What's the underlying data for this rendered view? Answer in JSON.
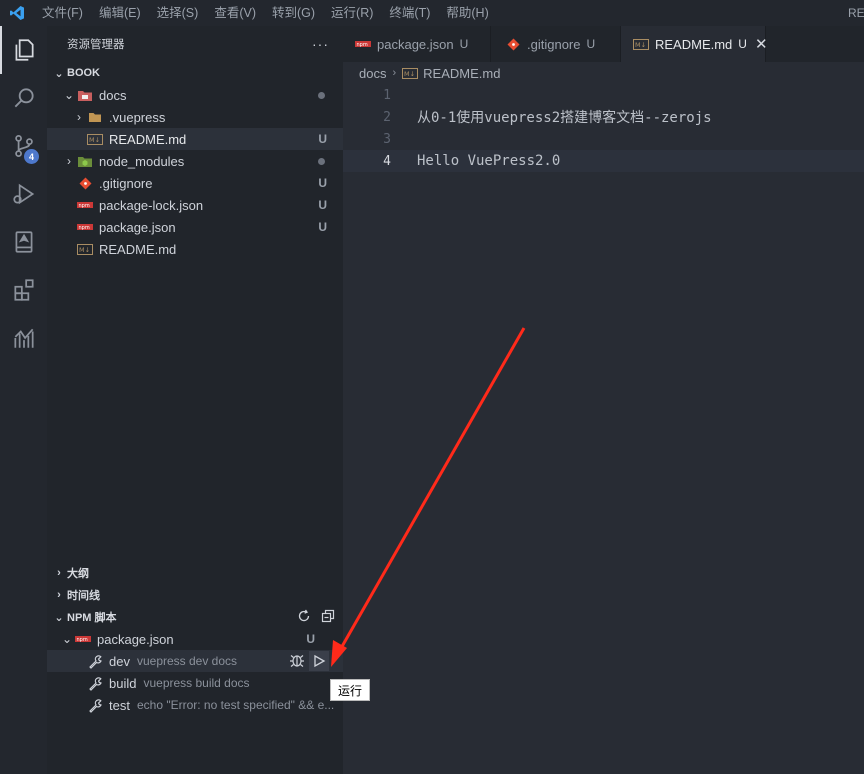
{
  "menubar": {
    "items": [
      "文件(F)",
      "编辑(E)",
      "选择(S)",
      "查看(V)",
      "转到(G)",
      "运行(R)",
      "终端(T)",
      "帮助(H)"
    ],
    "tail": "RE"
  },
  "activity": {
    "source_control_badge": "4",
    "icons": [
      "explorer-icon",
      "search-icon",
      "source-control-icon",
      "run-debug-icon",
      "bookmark-icon",
      "extensions-icon",
      "analytics-icon"
    ]
  },
  "explorer": {
    "title": "资源管理器",
    "more": "···",
    "folder": "BOOK",
    "tree": [
      {
        "label": "docs",
        "status": "",
        "dot": true
      },
      {
        "label": ".vuepress",
        "status": ""
      },
      {
        "label": "README.md",
        "status": "U"
      },
      {
        "label": "node_modules",
        "status": "",
        "dot": true
      },
      {
        "label": ".gitignore",
        "status": "U"
      },
      {
        "label": "package-lock.json",
        "status": "U"
      },
      {
        "label": "package.json",
        "status": "U"
      },
      {
        "label": "README.md",
        "status": ""
      }
    ]
  },
  "sections": {
    "outline": "大纲",
    "timeline": "时间线",
    "npm": "NPM 脚本"
  },
  "npm": {
    "file": "package.json",
    "file_status": "U",
    "scripts": [
      {
        "name": "dev",
        "command": "vuepress dev docs"
      },
      {
        "name": "build",
        "command": "vuepress build docs"
      },
      {
        "name": "test",
        "command": "echo \"Error: no test specified\" && e..."
      }
    ],
    "tooltip": "运行"
  },
  "tabs": [
    {
      "label": "package.json",
      "status": "U"
    },
    {
      "label": ".gitignore",
      "status": "U"
    },
    {
      "label": "README.md",
      "status": "U",
      "close": "✕"
    }
  ],
  "breadcrumb": {
    "folder": "docs",
    "file": "README.md"
  },
  "editor": {
    "lines": [
      {
        "num": "1",
        "text": ""
      },
      {
        "num": "2",
        "text": "从0-1使用vuepress2搭建博客文档--zerojs"
      },
      {
        "num": "3",
        "text": ""
      },
      {
        "num": "4",
        "text": "Hello VuePress2.0"
      }
    ]
  },
  "colors": {
    "accent": "#4d78cc",
    "arrow": "#ff2a1a",
    "git_untracked": "#9aa1ab"
  }
}
